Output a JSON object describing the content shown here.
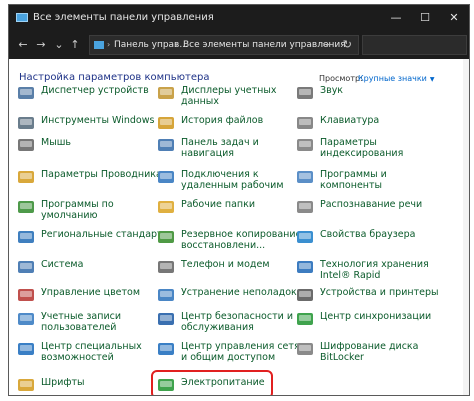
{
  "window": {
    "title": "Все элементы панели управления",
    "controls": {
      "minimize": "—",
      "maximize": "☐",
      "close": "✕"
    }
  },
  "nav": {
    "back_icon": "←",
    "forward_icon": "→",
    "history_icon": "⌄",
    "up_icon": "↑",
    "breadcrumb": [
      "Панель управ...",
      "Все элементы панели управления"
    ],
    "breadcrumb_sep": "›",
    "dropdown_icon": "⌄",
    "refresh_icon": "↻"
  },
  "content": {
    "heading": "Настройка параметров компьютера",
    "view_label": "Просмотр:",
    "view_value": "Крупные значки",
    "view_arrow": "▼"
  },
  "items": [
    {
      "label": "Диспетчер устройств",
      "icon": "device-manager-icon",
      "color": "#5a7fa8"
    },
    {
      "label": "Дисплеры учетных\nданных",
      "icon": "credential-manager-icon",
      "color": "#c9a24a"
    },
    {
      "label": "Звук",
      "icon": "sound-icon",
      "color": "#7a7a7a"
    },
    {
      "label": "Инструменты Windows",
      "icon": "windows-tools-icon",
      "color": "#6a7d8c"
    },
    {
      "label": "История файлов",
      "icon": "file-history-icon",
      "color": "#d6a53a"
    },
    {
      "label": "Клавиатура",
      "icon": "keyboard-icon",
      "color": "#888888"
    },
    {
      "label": "Мышь",
      "icon": "mouse-icon",
      "color": "#777777"
    },
    {
      "label": "Панель задач и\nнавигация",
      "icon": "taskbar-icon",
      "color": "#4f7fb5"
    },
    {
      "label": "Параметры\nиндексирования",
      "icon": "indexing-icon",
      "color": "#8a8a8a"
    },
    {
      "label": "Параметры Проводника",
      "icon": "explorer-options-icon",
      "color": "#d9a83b"
    },
    {
      "label": "Подключения к\nудаленным рабочим",
      "icon": "remote-desktop-icon",
      "color": "#4a86c5"
    },
    {
      "label": "Программы и\nкомпоненты",
      "icon": "programs-features-icon",
      "color": "#5b8fc7"
    },
    {
      "label": "Программы по\nумолчанию",
      "icon": "default-programs-icon",
      "color": "#4e9a4a"
    },
    {
      "label": "Рабочие папки",
      "icon": "work-folders-icon",
      "color": "#e0b040"
    },
    {
      "label": "Распознавание речи",
      "icon": "speech-recognition-icon",
      "color": "#8a8a8a"
    },
    {
      "label": "Региональные стандарты",
      "icon": "region-icon",
      "color": "#3f7fbf"
    },
    {
      "label": "Резервное копирование и\nвосстановлени...",
      "icon": "backup-icon",
      "color": "#4f9a45"
    },
    {
      "label": "Свойства браузера",
      "icon": "internet-options-icon",
      "color": "#3a8fd0"
    },
    {
      "label": "Система",
      "icon": "system-icon",
      "color": "#4f7fb5"
    },
    {
      "label": "Телефон и модем",
      "icon": "phone-modem-icon",
      "color": "#777777"
    },
    {
      "label": "Технология хранения\nIntel® Rapid",
      "icon": "intel-rst-icon",
      "color": "#3d7cc0"
    },
    {
      "label": "Управление цветом",
      "icon": "color-management-icon",
      "color": "#c0504d"
    },
    {
      "label": "Устранение неполадок",
      "icon": "troubleshooting-icon",
      "color": "#4a86c5"
    },
    {
      "label": "Устройства и принтеры",
      "icon": "devices-printers-icon",
      "color": "#6b6b6b"
    },
    {
      "label": "Учетные записи\nпользователей",
      "icon": "user-accounts-icon",
      "color": "#4e8ac8"
    },
    {
      "label": "Центр безопасности и\nобслуживания",
      "icon": "security-center-icon",
      "color": "#3a6fb0"
    },
    {
      "label": "Центр синхронизации",
      "icon": "sync-center-icon",
      "color": "#3fa34d"
    },
    {
      "label": "Центр специальных\nвозможностей",
      "icon": "ease-of-access-icon",
      "color": "#3a7fc5"
    },
    {
      "label": "Центр управления сетями\nи общим доступом",
      "icon": "network-center-icon",
      "color": "#3a7fc5"
    },
    {
      "label": "Шифрование диска\nBitLocker",
      "icon": "bitlocker-icon",
      "color": "#8a8a8a"
    },
    {
      "label": "Шрифты",
      "icon": "fonts-icon",
      "color": "#d9a83b"
    },
    {
      "label": "Электропитание",
      "icon": "power-options-icon",
      "color": "#3fa34d"
    }
  ]
}
